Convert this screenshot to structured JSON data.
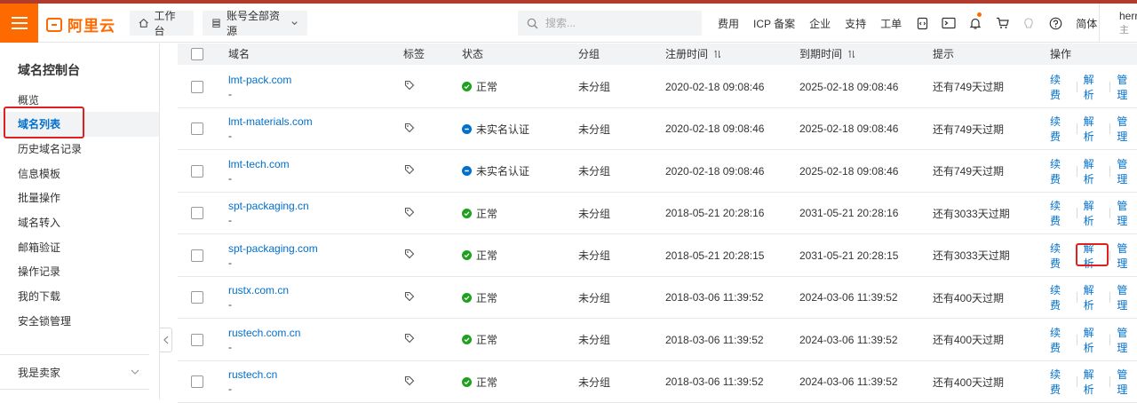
{
  "brand": {
    "logo_text": "阿里云",
    "accent": "#ff6a00",
    "link": "#0070cc"
  },
  "topbar": {
    "workbench_label": "工作台",
    "resources_label": "账号全部资源",
    "search_placeholder": "搜索...",
    "links": [
      "费用",
      "ICP 备案",
      "企业",
      "支持",
      "工单"
    ],
    "lang": "简体",
    "user_name": "herry",
    "user_sub": "主"
  },
  "sidebar": {
    "title": "域名控制台",
    "items": [
      {
        "label": "概览"
      },
      {
        "label": "域名列表",
        "active": true
      },
      {
        "label": "历史域名记录"
      },
      {
        "label": "信息模板"
      },
      {
        "label": "批量操作"
      },
      {
        "label": "域名转入"
      },
      {
        "label": "邮箱验证"
      },
      {
        "label": "操作记录"
      },
      {
        "label": "我的下载"
      },
      {
        "label": "安全锁管理"
      }
    ],
    "seller_label": "我是卖家"
  },
  "table": {
    "headers": {
      "domain": "域名",
      "tag": "标签",
      "status": "状态",
      "group": "分组",
      "reg_time": "注册时间",
      "exp_time": "到期时间",
      "hint": "提示",
      "ops": "操作"
    },
    "actions": {
      "renew": "续费",
      "resolve": "解析",
      "manage": "管理"
    },
    "rows": [
      {
        "domain": "lmt-pack.com",
        "sub": "-",
        "status": "正常",
        "status_type": "ok",
        "group": "未分组",
        "reg": "2020-02-18 09:08:46",
        "exp": "2025-02-18 09:08:46",
        "hint": "还有749天过期"
      },
      {
        "domain": "lmt-materials.com",
        "sub": "-",
        "status": "未实名认证",
        "status_type": "warn",
        "group": "未分组",
        "reg": "2020-02-18 09:08:46",
        "exp": "2025-02-18 09:08:46",
        "hint": "还有749天过期"
      },
      {
        "domain": "lmt-tech.com",
        "sub": "-",
        "status": "未实名认证",
        "status_type": "warn",
        "group": "未分组",
        "reg": "2020-02-18 09:08:46",
        "exp": "2025-02-18 09:08:46",
        "hint": "还有749天过期"
      },
      {
        "domain": "spt-packaging.cn",
        "sub": "-",
        "status": "正常",
        "status_type": "ok",
        "group": "未分组",
        "reg": "2018-05-21 20:28:16",
        "exp": "2031-05-21 20:28:16",
        "hint": "还有3033天过期"
      },
      {
        "domain": "spt-packaging.com",
        "sub": "-",
        "status": "正常",
        "status_type": "ok",
        "group": "未分组",
        "reg": "2018-05-21 20:28:15",
        "exp": "2031-05-21 20:28:15",
        "hint": "还有3033天过期"
      },
      {
        "domain": "rustx.com.cn",
        "sub": "-",
        "status": "正常",
        "status_type": "ok",
        "group": "未分组",
        "reg": "2018-03-06 11:39:52",
        "exp": "2024-03-06 11:39:52",
        "hint": "还有400天过期"
      },
      {
        "domain": "rustech.com.cn",
        "sub": "-",
        "status": "正常",
        "status_type": "ok",
        "group": "未分组",
        "reg": "2018-03-06 11:39:52",
        "exp": "2024-03-06 11:39:52",
        "hint": "还有400天过期"
      },
      {
        "domain": "rustech.cn",
        "sub": "-",
        "status": "正常",
        "status_type": "ok",
        "group": "未分组",
        "reg": "2018-03-06 11:39:52",
        "exp": "2024-03-06 11:39:52",
        "hint": "还有400天过期"
      }
    ]
  }
}
